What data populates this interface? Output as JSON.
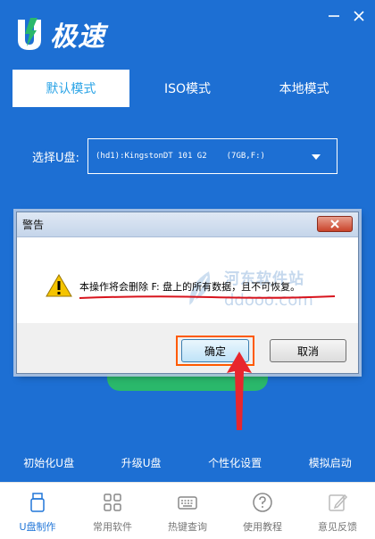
{
  "app": {
    "logo_text": "极速",
    "colors": {
      "primary": "#1d6fd3",
      "accent": "#29a3e6",
      "green": "#2ab86b"
    }
  },
  "tabs": [
    {
      "label": "默认模式",
      "active": true
    },
    {
      "label": "ISO模式",
      "active": false
    },
    {
      "label": "本地模式",
      "active": false
    }
  ],
  "select": {
    "label": "选择U盘:",
    "device": "(hd1):KingstonDT 101 G2",
    "size": "(7GB,F:)"
  },
  "bottom_links": [
    "初始化U盘",
    "升级U盘",
    "个性化设置",
    "模拟启动"
  ],
  "nav": [
    {
      "label": "U盘制作",
      "icon": "usb-drive-icon",
      "active": true
    },
    {
      "label": "常用软件",
      "icon": "apps-grid-icon",
      "active": false
    },
    {
      "label": "热键查询",
      "icon": "keyboard-icon",
      "active": false
    },
    {
      "label": "使用教程",
      "icon": "help-icon",
      "active": false
    },
    {
      "label": "意见反馈",
      "icon": "feedback-icon",
      "active": false
    }
  ],
  "dialog": {
    "title": "警告",
    "message": "本操作将会删除 F: 盘上的所有数据，且不可恢复。",
    "ok_label": "确定",
    "cancel_label": "取消",
    "watermark_line1": "河东软件站",
    "watermark_line2": "ddooo.com"
  }
}
